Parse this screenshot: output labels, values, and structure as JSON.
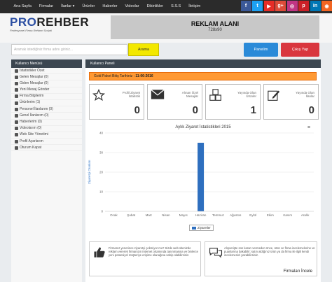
{
  "topnav": {
    "items": [
      "Ana Sayfa",
      "Firmalar",
      "İlanlar ▾",
      "Ürünler",
      "Haberler",
      "Videolar",
      "Etkinlikler",
      "S.S.S",
      "İletişim"
    ],
    "social": [
      {
        "name": "facebook-icon",
        "glyph": "f",
        "color": "#3b5998"
      },
      {
        "name": "twitter-icon",
        "glyph": "t",
        "color": "#1da1f2"
      },
      {
        "name": "youtube-icon",
        "glyph": "▶",
        "color": "#e52d27"
      },
      {
        "name": "google-plus-icon",
        "glyph": "g+",
        "color": "#dd4b39"
      },
      {
        "name": "instagram-icon",
        "glyph": "◎",
        "color": "#c13584"
      },
      {
        "name": "pinterest-icon",
        "glyph": "p",
        "color": "#cb2027"
      },
      {
        "name": "linkedin-icon",
        "glyph": "in",
        "color": "#0077b5"
      },
      {
        "name": "rss-icon",
        "glyph": "◉",
        "color": "#f26522"
      }
    ]
  },
  "logo": {
    "part1": "PRO",
    "part2": "REHBER",
    "tagline": "Profesyonel Firma Rehberi Scripti"
  },
  "ad": {
    "title": "REKLAM ALANI",
    "size": "728x90"
  },
  "search": {
    "placeholder": "Aramak istediğiniz firma adını giriniz...",
    "button": "Arama"
  },
  "actions": {
    "panel": "Panelim",
    "exit": "Çıkış Yap"
  },
  "sidebar": {
    "title": "Kullanıcı Menüsü",
    "items": [
      "İstatistikler Özet",
      "Gelen Mesajlar (0)",
      "Giden Mesajlar (0)",
      "Yeni Mesaj Gönder",
      "Firma Bilgilerim",
      "Ürünlerim (1)",
      "Personel İlanlarım (0)",
      "Genel İlanlarım (0)",
      "Haberlerim (0)",
      "Videolarım (0)",
      "Web Site Yönetimi",
      "Profil Ayarlarım",
      "Oturum Kapat"
    ]
  },
  "main": {
    "title": "Kullanıcı Paneli",
    "alert_label": "Gold Paket Bitiş Tarihiniz :",
    "alert_date": "11-06-2016",
    "stats": [
      {
        "label": "Profil Ziyaret İstatistik",
        "value": "0",
        "icon": "star-icon"
      },
      {
        "label": "Alınan Özel Mesajlar",
        "value": "0",
        "icon": "envelope-icon"
      },
      {
        "label": "Yayında Olan Ürünler",
        "value": "1",
        "icon": "cubes-icon"
      },
      {
        "label": "Yayında Olan İlanlar",
        "value": "0",
        "icon": "edit-icon"
      }
    ]
  },
  "boxes": {
    "left_text": "Firmanız yenerince ziyaretçi çekmiyor mu? Sizde web sitenizde reklam vererek firmanızın internet ortamında tanınmasına ve binlerce yeni potansiyel müşteriye erişime olanağına sahip olabilirsiniz.",
    "right_text": "Alışverişte son kararı vermeden önce, ürün ve firma incelemelerine ve puanlarına bakabilir; satın aldığınız ürün ya da firma ile ilgili kendi incelemenizi yazabilirsiniz.",
    "right_footer": "Firmaları İncele"
  },
  "chart_data": {
    "type": "bar",
    "title": "Aylık Ziyaret İstatistikleri 2015",
    "xlabel": "",
    "ylabel": "Ziyaretçi Oranları",
    "categories": [
      "Ocak",
      "Şubat",
      "Mart",
      "Nisan",
      "Mayıs",
      "Haziran",
      "Temmuz",
      "Ağustos",
      "Eylül",
      "Ekim",
      "Kasım",
      "Aralık"
    ],
    "series": [
      {
        "name": "Ziyaretler",
        "values": [
          0,
          0,
          0,
          0,
          0,
          35,
          0,
          0,
          0,
          0,
          0,
          0
        ]
      }
    ],
    "ylim": [
      0,
      40
    ],
    "yticks": [
      0,
      10,
      20,
      30,
      40
    ],
    "color": "#2e6fbf",
    "grid": true,
    "legend": "bottom"
  }
}
